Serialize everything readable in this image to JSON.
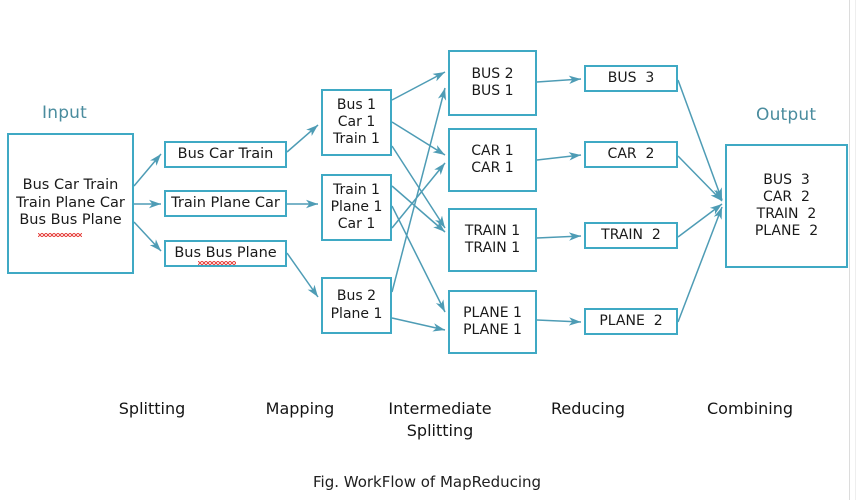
{
  "figure": {
    "caption": "Fig. WorkFlow of MapReducing",
    "accent_color": "#3fa9c4",
    "title_color": "#4a8c9e",
    "arrow_color": "#4e9cb5",
    "background": "#ffffff"
  },
  "headings": {
    "input": "Input",
    "output": "Output"
  },
  "stage_labels": [
    {
      "name": "splitting",
      "text": "Splitting"
    },
    {
      "name": "mapping",
      "text": "Mapping"
    },
    {
      "name": "intermediate",
      "text": "Intermediate\nSplitting"
    },
    {
      "name": "reducing",
      "text": "Reducing"
    },
    {
      "name": "combining",
      "text": "Combining"
    }
  ],
  "input_box": {
    "lines": [
      "Bus Car Train",
      "Train Plane Car",
      "Bus Bus Plane"
    ]
  },
  "splitting_boxes": [
    {
      "lines": [
        "Bus Car Train"
      ]
    },
    {
      "lines": [
        "Train Plane Car"
      ]
    },
    {
      "lines": [
        "Bus Bus Plane"
      ]
    }
  ],
  "mapping_boxes": [
    {
      "lines": [
        "Bus 1",
        "Car 1",
        "Train 1"
      ]
    },
    {
      "lines": [
        "Train 1",
        "Plane 1",
        "Car 1"
      ]
    },
    {
      "lines": [
        "Bus 2",
        "Plane 1"
      ]
    }
  ],
  "intermediate_boxes": [
    {
      "lines": [
        "BUS 2",
        "BUS 1"
      ]
    },
    {
      "lines": [
        "CAR 1",
        "CAR 1"
      ]
    },
    {
      "lines": [
        "TRAIN 1",
        "TRAIN 1"
      ]
    },
    {
      "lines": [
        "PLANE 1",
        "PLANE 1"
      ]
    }
  ],
  "reducing_boxes": [
    {
      "lines": [
        "BUS  3"
      ]
    },
    {
      "lines": [
        "CAR  2"
      ]
    },
    {
      "lines": [
        "TRAIN  2"
      ]
    },
    {
      "lines": [
        "PLANE  2"
      ]
    }
  ],
  "output_box": {
    "lines": [
      "BUS  3",
      "CAR  2",
      "TRAIN  2",
      "PLANE  2"
    ]
  }
}
